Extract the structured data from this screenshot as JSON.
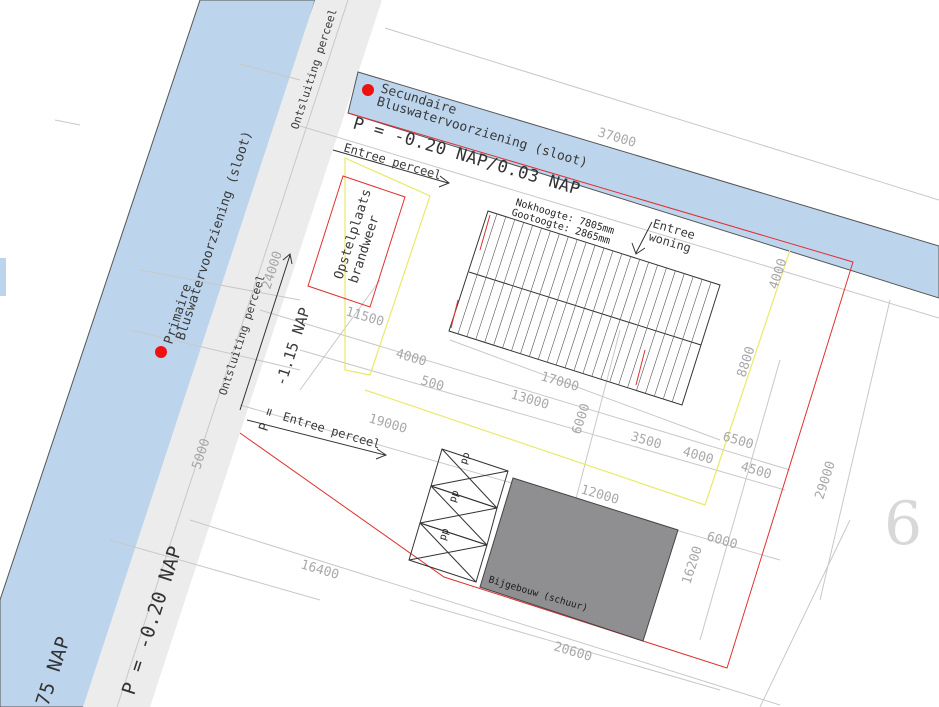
{
  "colors": {
    "water": "#bcd5ec",
    "road": "#ececec",
    "building": "#8f8f92",
    "site_line": "#e03030",
    "building_line": "#e9e96a",
    "hydrant_dot": "#ee1111"
  },
  "water_primary": {
    "line1": "Primaire",
    "line2": "Bluswatervoorziening (sloot)",
    "level": "75 NAP"
  },
  "water_secondary": {
    "line1": "Secundaire",
    "line2": "Bluswatervoorziening (sloot)",
    "level": "P = -0.20 NAP/0.03 NAP"
  },
  "road": {
    "connection_top": "Ontsluiting perceel",
    "connection_mid": "Ontsluiting perceel",
    "level": "P = -0.20 NAP"
  },
  "site": {
    "entry_top": "Entree perceel",
    "entry_bottom": "Entree perceel",
    "entry_bottom_prefix": "P =",
    "level_left": "-1.15 NAP",
    "fire_area": [
      "Opstelplaats",
      "brandweer"
    ],
    "entrance_house": [
      "Entree",
      "woning"
    ],
    "ridge_height": "Nokhoogte: 7805mm",
    "eaves_height": "Gootoogte: 2865mm",
    "shed": "Bijgebouw (schuur)",
    "parking": [
      "pp",
      "pp",
      "pp"
    ],
    "plot_number": "6"
  },
  "dimensions": [
    "37000",
    "24000",
    "5000",
    "11500",
    "4000",
    "500",
    "17000",
    "13000",
    "19000",
    "6000",
    "3500",
    "4000",
    "6500",
    "4500",
    "8800",
    "4000",
    "12000",
    "6000",
    "16200",
    "16400",
    "20600",
    "29000"
  ]
}
